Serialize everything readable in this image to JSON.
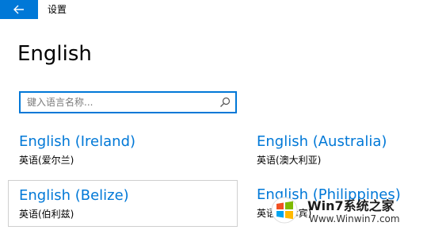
{
  "window": {
    "title": "设置",
    "back_icon": "back-arrow-icon",
    "accent_color": "#0078d7"
  },
  "page": {
    "title": "English"
  },
  "search": {
    "placeholder": "键入语言名称...",
    "value": "",
    "icon": "search-icon"
  },
  "languages": [
    {
      "name": "English (Ireland)",
      "native": "英语(爱尔兰)"
    },
    {
      "name": "English (Australia)",
      "native": "英语(澳大利亚)"
    },
    {
      "name": "English (Belize)",
      "native": "英语(伯利兹)"
    },
    {
      "name": "English (Philippines)",
      "native": "英语(菲律宾)"
    }
  ],
  "watermark": {
    "brand": "Win7系统之家",
    "url": "Www.Winwin7.com"
  }
}
